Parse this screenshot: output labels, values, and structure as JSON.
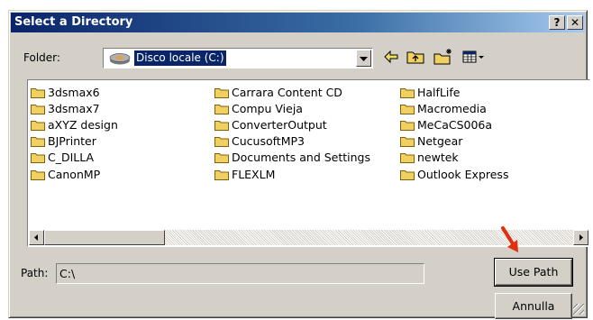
{
  "window": {
    "title": "Select a Directory"
  },
  "titlebar_buttons": {
    "help": "?",
    "close": "✕"
  },
  "folder": {
    "label": "Folder:",
    "selected": "Disco locale (C:)",
    "icon": "hard-drive-icon"
  },
  "toolbar": {
    "icons": [
      "back-arrow-icon",
      "up-folder-icon",
      "new-folder-icon",
      "view-menu-icon"
    ]
  },
  "directories": {
    "columns": [
      [
        "3dsmax6",
        "3dsmax7",
        "aXYZ design",
        "BJPrinter",
        "C_DILLA",
        "CanonMP"
      ],
      [
        "Carrara Content CD",
        "Compu Vieja",
        "ConverterOutput",
        "CucusoftMP3",
        "Documents and Settings",
        "FLEXLM"
      ],
      [
        "HalfLife",
        "Macromedia",
        "MeCaCS006a",
        "Netgear",
        "newtek",
        "Outlook Express"
      ]
    ]
  },
  "path": {
    "label": "Path:",
    "value": "C:\\"
  },
  "buttons": {
    "use_path": "Use Path",
    "cancel": "Annulla"
  },
  "colors": {
    "titlebar_start": "#0a246a",
    "titlebar_end": "#a6caf0",
    "folder_icon": "#f0d060",
    "annotation_arrow": "#e03010"
  }
}
